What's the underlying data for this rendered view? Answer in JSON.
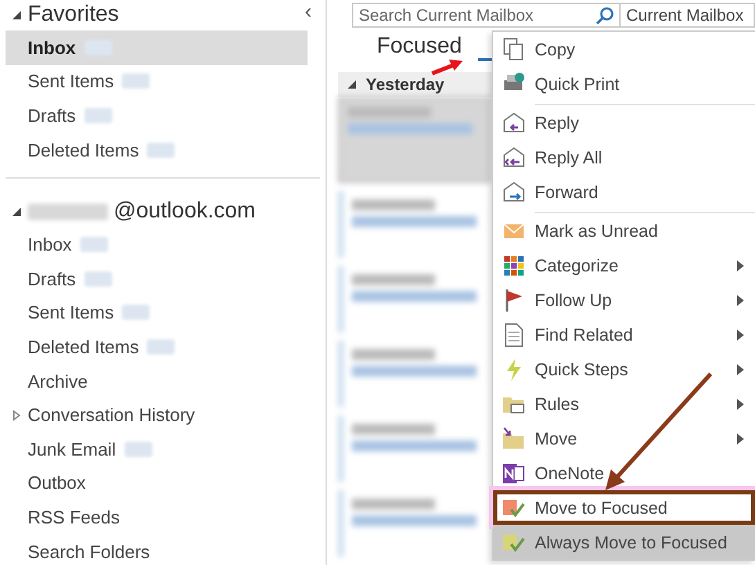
{
  "sidebar": {
    "collapse_glyph": "‹",
    "favorites": {
      "title": "Favorites",
      "expanded": true,
      "items": [
        {
          "label": "Inbox",
          "selected": true,
          "redacted": true
        },
        {
          "label": "Sent Items",
          "selected": false,
          "redacted": true
        },
        {
          "label": "Drafts",
          "selected": false,
          "redacted": true
        },
        {
          "label": "Deleted Items",
          "selected": false,
          "redacted": true
        }
      ]
    },
    "account": {
      "title": "@outlook.com",
      "expanded": true,
      "items": [
        {
          "label": "Inbox",
          "selected": false,
          "redacted": true,
          "expandable": false
        },
        {
          "label": "Drafts",
          "selected": false,
          "redacted": true,
          "expandable": false
        },
        {
          "label": "Sent Items",
          "selected": false,
          "redacted": true,
          "expandable": false
        },
        {
          "label": "Deleted Items",
          "selected": false,
          "redacted": true,
          "expandable": false
        },
        {
          "label": "Archive",
          "selected": false,
          "redacted": false,
          "expandable": false
        },
        {
          "label": "Conversation History",
          "selected": false,
          "redacted": false,
          "expandable": true
        },
        {
          "label": "Junk Email",
          "selected": false,
          "redacted": true,
          "expandable": false
        },
        {
          "label": "Outbox",
          "selected": false,
          "redacted": false,
          "expandable": false
        },
        {
          "label": "RSS Feeds",
          "selected": false,
          "redacted": false,
          "expandable": false
        },
        {
          "label": "Search Folders",
          "selected": false,
          "redacted": false,
          "expandable": false
        }
      ]
    }
  },
  "search": {
    "placeholder": "Search Current Mailbox",
    "scope": "Current Mailbox"
  },
  "tabs": [
    {
      "label": "Focused",
      "selected": false
    }
  ],
  "message_list": {
    "group": "Yesterday",
    "items": [
      {
        "selected": true
      },
      {
        "selected": false
      },
      {
        "selected": false
      },
      {
        "selected": false
      },
      {
        "selected": false
      },
      {
        "selected": false
      }
    ]
  },
  "context_menu": {
    "items": [
      {
        "label": "Copy",
        "submenu": false,
        "hovered": false,
        "outlined": false,
        "separator_after": false
      },
      {
        "label": "Quick Print",
        "submenu": false,
        "hovered": false,
        "outlined": false,
        "separator_after": true
      },
      {
        "label": "Reply",
        "submenu": false,
        "hovered": false,
        "outlined": false,
        "separator_after": false
      },
      {
        "label": "Reply All",
        "submenu": false,
        "hovered": false,
        "outlined": false,
        "separator_after": false
      },
      {
        "label": "Forward",
        "submenu": false,
        "hovered": false,
        "outlined": false,
        "separator_after": true
      },
      {
        "label": "Mark as Unread",
        "submenu": false,
        "hovered": false,
        "outlined": false,
        "separator_after": false
      },
      {
        "label": "Categorize",
        "submenu": true,
        "hovered": false,
        "outlined": false,
        "separator_after": false
      },
      {
        "label": "Follow Up",
        "submenu": true,
        "hovered": false,
        "outlined": false,
        "separator_after": false
      },
      {
        "label": "Find Related",
        "submenu": true,
        "hovered": false,
        "outlined": false,
        "separator_after": false
      },
      {
        "label": "Quick Steps",
        "submenu": true,
        "hovered": false,
        "outlined": false,
        "separator_after": false
      },
      {
        "label": "Rules",
        "submenu": true,
        "hovered": false,
        "outlined": false,
        "separator_after": false
      },
      {
        "label": "Move",
        "submenu": true,
        "hovered": false,
        "outlined": false,
        "separator_after": false
      },
      {
        "label": "OneNote",
        "submenu": false,
        "hovered": false,
        "outlined": false,
        "separator_after": false
      },
      {
        "label": "Move to Focused",
        "submenu": false,
        "hovered": false,
        "outlined": true,
        "separator_after": false
      },
      {
        "label": "Always Move to Focused",
        "submenu": false,
        "hovered": true,
        "outlined": false,
        "separator_after": false
      }
    ]
  }
}
